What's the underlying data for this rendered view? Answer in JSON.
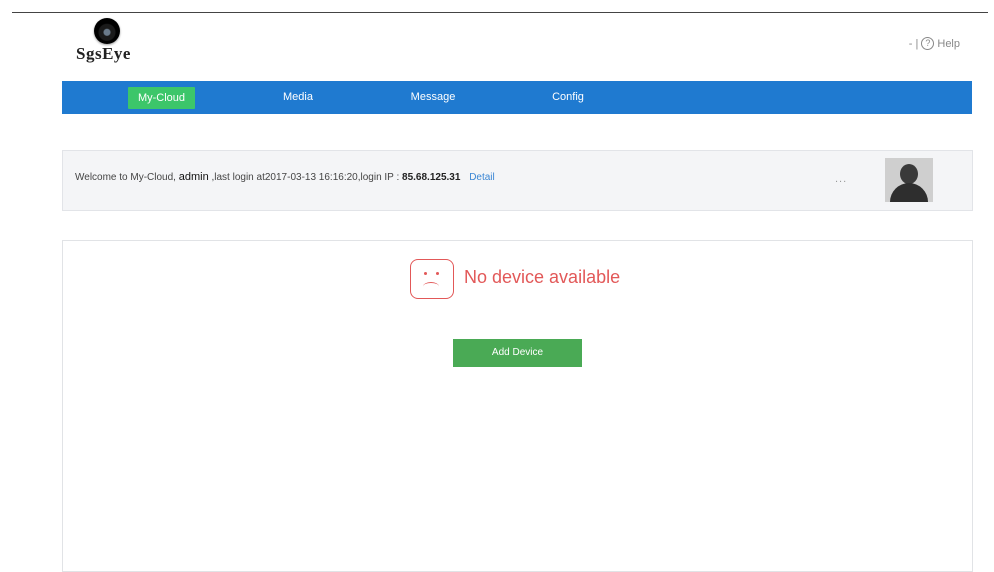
{
  "header": {
    "logo_text": "SgsEye",
    "help_separator": "- |",
    "help_label": "Help"
  },
  "nav": {
    "items": [
      {
        "label": "My-Cloud",
        "active": true
      },
      {
        "label": "Media",
        "active": false
      },
      {
        "label": "Message",
        "active": false
      },
      {
        "label": "Config",
        "active": false
      }
    ]
  },
  "welcome": {
    "prefix": "Welcome to My-Cloud,",
    "username": "admin",
    "last_login_text": ",last login at2017-03-13 16:16:20,login IP :",
    "ip": "85.68.125.31",
    "detail_link": "Detail",
    "more": "..."
  },
  "main": {
    "empty_message": "No device available",
    "add_device_label": "Add Device"
  },
  "icons": {
    "logo": "camera-lens-icon",
    "help": "question-circle-icon",
    "empty_state": "sad-face-icon",
    "avatar": "user-silhouette-icon"
  },
  "colors": {
    "nav_bg": "#1f7ad0",
    "nav_active": "#3cc66a",
    "error_red": "#e25858",
    "button_green": "#4aaa55",
    "link_blue": "#3a86d4"
  }
}
